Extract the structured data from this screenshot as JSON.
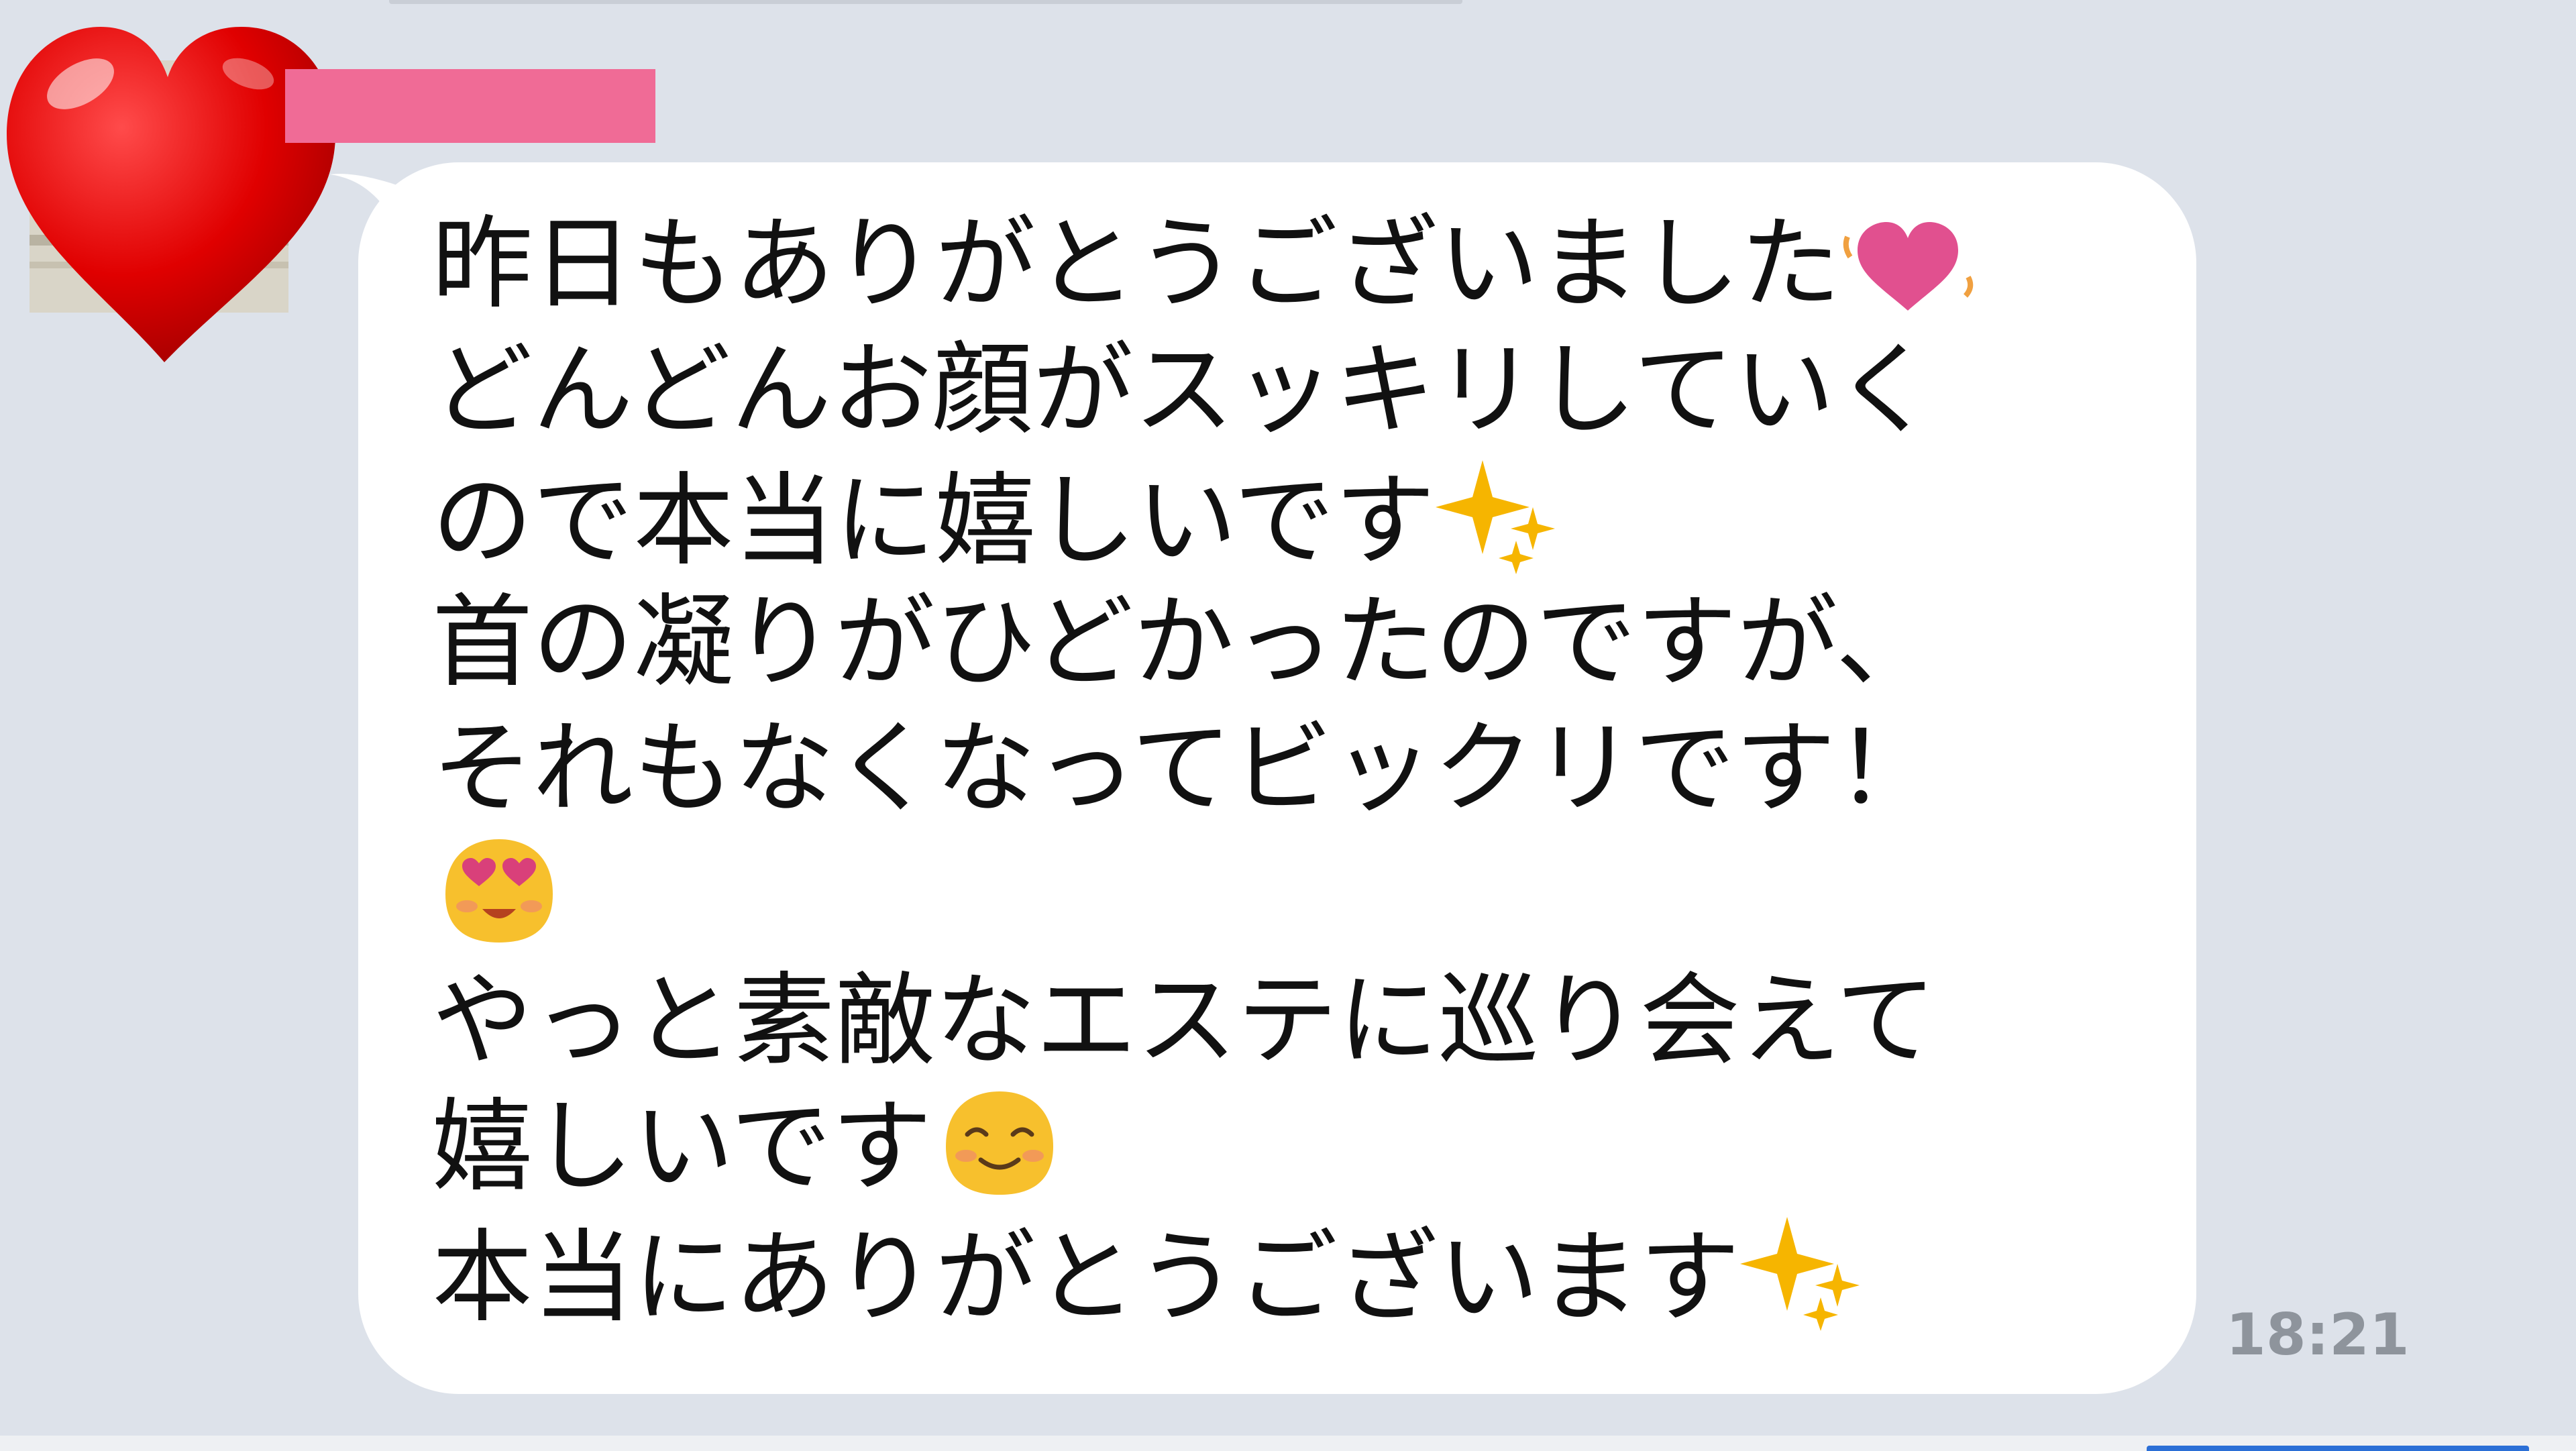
{
  "chat": {
    "sender_name_redacted": "",
    "timestamp": "18:21",
    "message_lines": [
      "昨日もありがとうございました",
      "どんどんお顔がスッキリしていく",
      "ので本当に嬉しいです",
      "首の凝りがひどかったのですが、",
      "それもなくなってビックリです！",
      "",
      "やっと素敵なエステに巡り会えて",
      "嬉しいです",
      "本当にありがとうございます"
    ],
    "emojis": {
      "line0_end": "beating-heart-icon",
      "line2_end": "sparkles-icon",
      "line5_alone": "heart-eyes-face-icon",
      "line7_end": "smiling-face-icon",
      "line8_end": "sparkles-icon"
    }
  },
  "colors": {
    "chat_background": "#dde2ea",
    "bubble": "#ffffff",
    "name_highlight": "#f06b96",
    "timestamp": "#8e949c"
  }
}
